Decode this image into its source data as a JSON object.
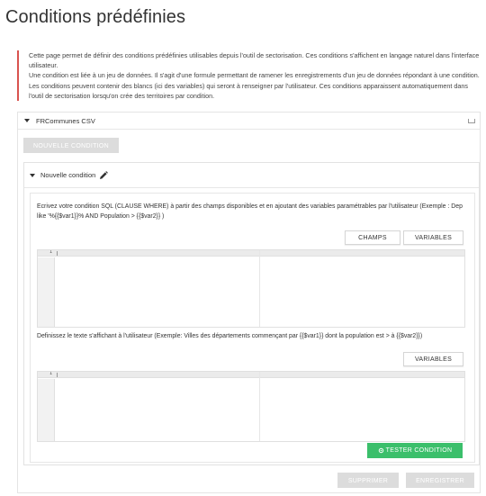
{
  "page": {
    "title": "Conditions prédéfinies"
  },
  "info": {
    "paragraphs": [
      "Cette page permet de définir des conditions prédéfinies utilisables depuis l'outil de sectorisation. Ces conditions s'affichent en langage naturel dans l'interface utilisateur.",
      "Une condition est liée à un jeu de données. Il s'agit d'une formule permettant de ramener les enregistrements d'un jeu de données répondant à une condition. Les conditions peuvent contenir des blancs (ici des variables) qui seront à renseigner par l'utilisateur. Ces conditions apparaissent automatiquement dans l'outil de sectorisation lorsqu'on crée des territoires par condition."
    ]
  },
  "dataset": {
    "name": "FRCommunes CSV",
    "new_condition_label": "NOUVELLE CONDITION"
  },
  "condition": {
    "title": "Nouvelle condition",
    "sql_help": "Ecrivez votre condition SQL (CLAUSE WHERE) à partir des champs disponibles et en ajoutant des variables paramétrables par l'utilisateur (Exemple : Dep like '%{{$var1}}% AND Population > {{$var2}} )",
    "fields_label": "CHAMPS",
    "variables_label": "VARIABLES",
    "sql_editor_line": "1",
    "text_help": "Definissez le texte s'affichant à l'utilisateur (Exemple: Villes des départements commençant par {{$var1}} dont la population est > à {{$var2}})",
    "variables2_label": "VARIABLES",
    "text_editor_line": "1",
    "test_label": "TESTER CONDITION"
  },
  "actions": {
    "delete_label": "SUPPRIMER",
    "save_label": "ENREGISTRER"
  },
  "colors": {
    "accent_green": "#3bbf6b",
    "info_border_red": "#d9534f",
    "disabled_grey": "#dcdcdc"
  },
  "icons": {
    "collapse": "caret-down-icon",
    "edit": "pencil-icon",
    "test": "gear-icon",
    "minimize": "minimize-icon"
  }
}
